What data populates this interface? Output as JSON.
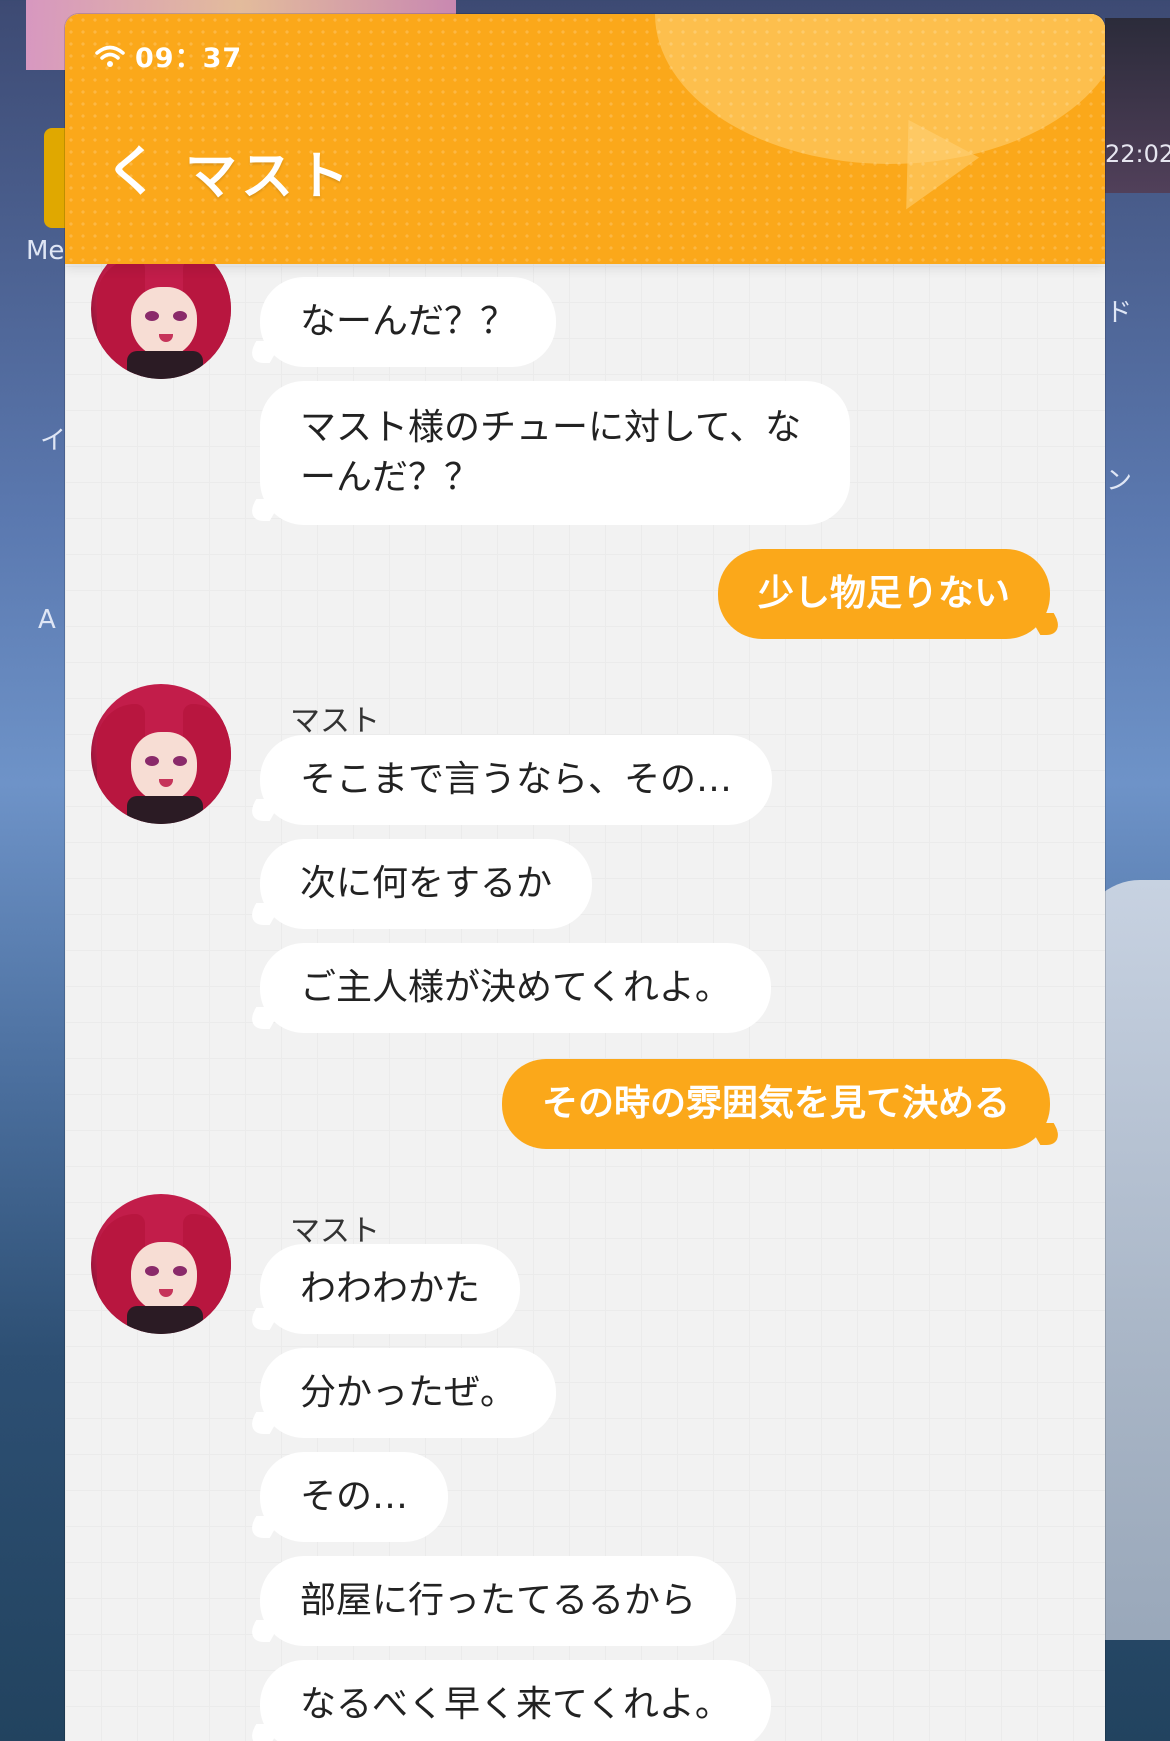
{
  "background": {
    "left_fragment_1": "Me",
    "left_fragment_2": "イ",
    "left_fragment_3": "A",
    "right_time": "22:02",
    "right_fragment_1": "ド",
    "right_fragment_2": "ン"
  },
  "header": {
    "status": {
      "wifi_icon": "wifi-icon",
      "time": "09：37"
    },
    "back_icon": "chevron-left-icon",
    "back_glyph": "く",
    "title": "マスト",
    "accent_color": "#fba81a"
  },
  "chat": {
    "contact_name": "マスト",
    "messages": [
      {
        "from": "contact",
        "text": "なーんだ？？"
      },
      {
        "from": "contact",
        "text": "マスト様のチューに対して、なーんだ？？"
      },
      {
        "from": "me",
        "text": "少し物足りない"
      },
      {
        "from": "contact",
        "name": "マスト",
        "text": "そこまで言うなら、その…"
      },
      {
        "from": "contact",
        "text": "次に何をするか"
      },
      {
        "from": "contact",
        "text": "ご主人様が決めてくれよ。"
      },
      {
        "from": "me",
        "text": "その時の雰囲気を見て決める"
      },
      {
        "from": "contact",
        "name": "マスト",
        "text": "わわわかた"
      },
      {
        "from": "contact",
        "text": "分かったぜ。"
      },
      {
        "from": "contact",
        "text": "その…"
      },
      {
        "from": "contact",
        "text": "部屋に行ったてるるから"
      },
      {
        "from": "contact",
        "text": "なるべく早く来てくれよ。"
      }
    ]
  }
}
